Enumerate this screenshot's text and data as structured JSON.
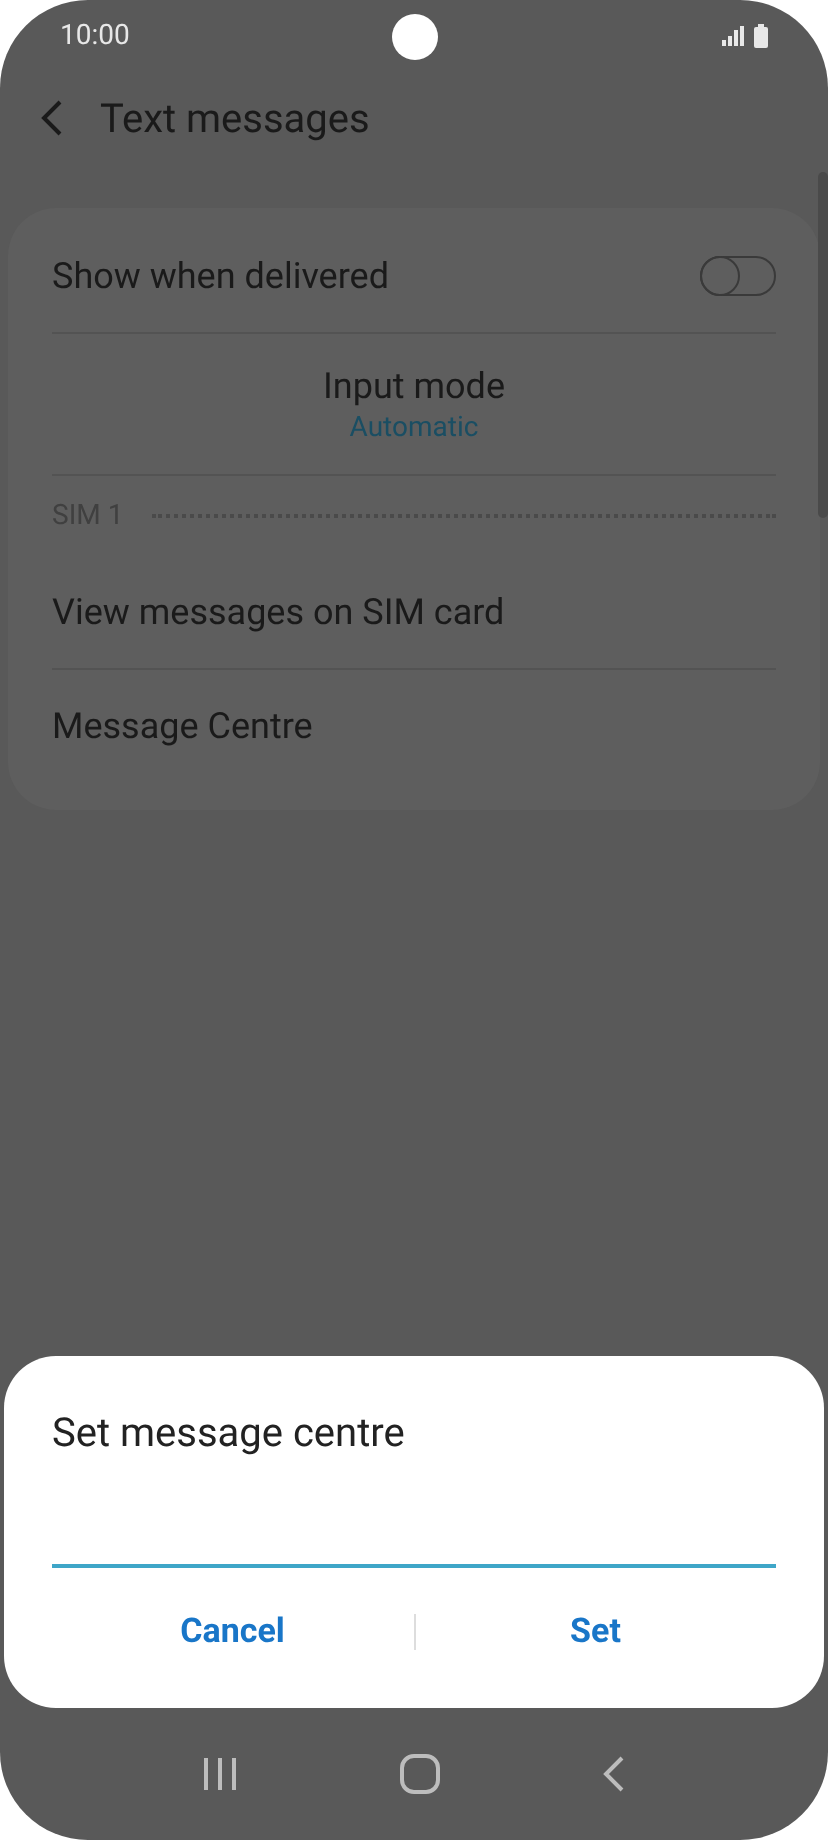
{
  "status_bar": {
    "time": "10:00"
  },
  "header": {
    "title": "Text messages"
  },
  "settings": [
    {
      "kind": "toggle",
      "label": "Show when delivered",
      "on": false
    },
    {
      "kind": "subtitle",
      "label": "Input mode",
      "value": "Automatic"
    },
    {
      "kind": "section",
      "label": "SIM 1"
    },
    {
      "kind": "plain",
      "label": "View messages on SIM card"
    },
    {
      "kind": "plain",
      "label": "Message Centre"
    }
  ],
  "dialog": {
    "title": "Set message centre",
    "buttons": [
      "Cancel",
      "Set"
    ]
  }
}
